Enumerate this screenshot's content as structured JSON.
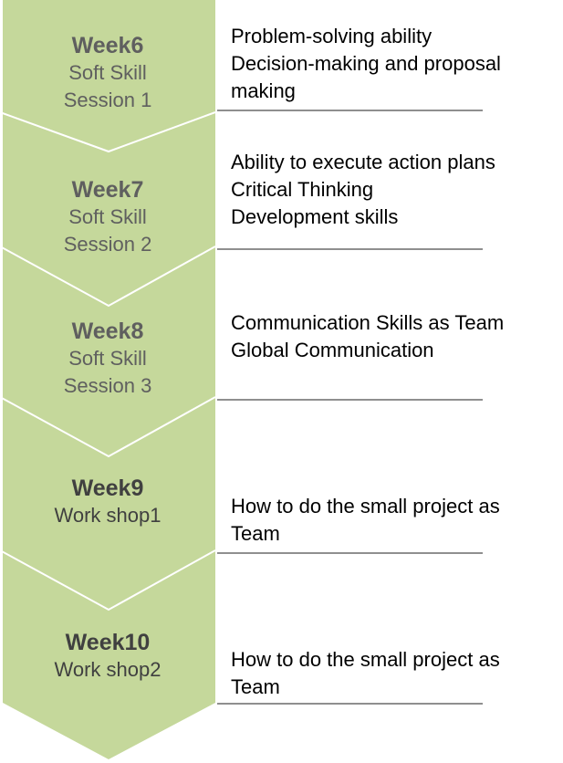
{
  "colors": {
    "fill": "#c5d89b",
    "divider": "#ffffff",
    "rule": "#8f8f8f",
    "stage_text": "#5f5f5f",
    "stage_text_dark": "#404040"
  },
  "stages": [
    {
      "week": "Week6",
      "lines": [
        "Soft Skill",
        "Session 1"
      ],
      "desc": [
        "Problem-solving ability",
        "Decision-making and proposal",
        "making"
      ]
    },
    {
      "week": "Week7",
      "lines": [
        "Soft Skill",
        "Session 2"
      ],
      "desc": [
        "Ability to execute action plans",
        "Critical Thinking",
        "Development skills"
      ]
    },
    {
      "week": "Week8",
      "lines": [
        "Soft Skill",
        "Session 3"
      ],
      "desc": [
        "Communication Skills as Team",
        "Global Communication"
      ]
    },
    {
      "week": "Week9",
      "lines": [
        "Work shop1"
      ],
      "desc": [
        "How to do the small project as",
        "Team"
      ]
    },
    {
      "week": "Week10",
      "lines": [
        "Work shop2"
      ],
      "desc": [
        "How to do the small project as",
        "Team"
      ]
    }
  ]
}
